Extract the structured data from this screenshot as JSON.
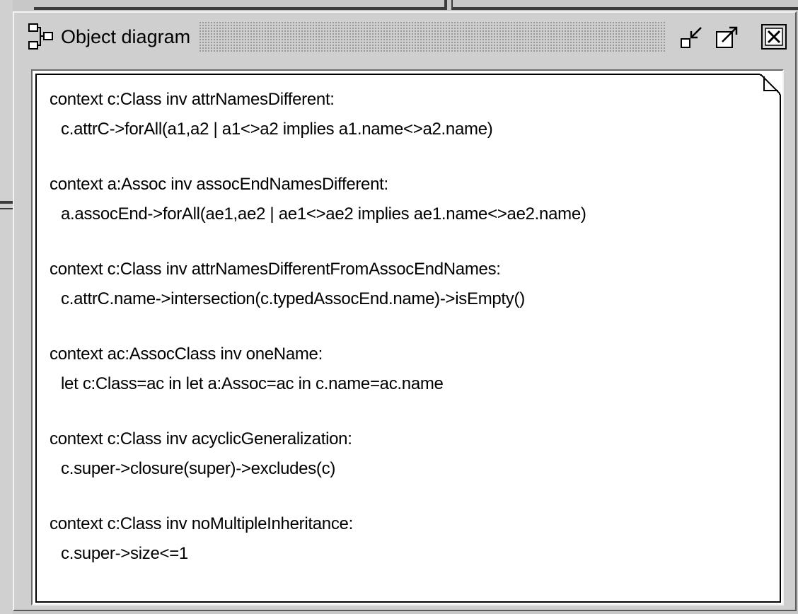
{
  "window": {
    "title": "Object diagram",
    "icons": {
      "title": "object-diagram-icon",
      "minimize": "iconify-icon",
      "maximize": "maximize-icon",
      "close": "close-icon"
    }
  },
  "note": {
    "invariants": [
      {
        "header": "context c:Class inv attrNamesDifferent:",
        "body": "c.attrC->forAll(a1,a2 | a1<>a2 implies a1.name<>a2.name)"
      },
      {
        "header": "context a:Assoc inv assocEndNamesDifferent:",
        "body": "a.assocEnd->forAll(ae1,ae2 | ae1<>ae2 implies ae1.name<>ae2.name)"
      },
      {
        "header": "context c:Class inv attrNamesDifferentFromAssocEndNames:",
        "body": "c.attrC.name->intersection(c.typedAssocEnd.name)->isEmpty()"
      },
      {
        "header": "context ac:AssocClass inv oneName:",
        "body": "let c:Class=ac in let a:Assoc=ac in c.name=ac.name"
      },
      {
        "header": "context c:Class inv acyclicGeneralization:",
        "body": "c.super->closure(super)->excludes(c)"
      },
      {
        "header": "context c:Class inv noMultipleInheritance:",
        "body": "c.super->size<=1"
      }
    ]
  },
  "colors": {
    "frame": "#cfcfcf",
    "content": "#ffffff",
    "text": "#000000"
  }
}
